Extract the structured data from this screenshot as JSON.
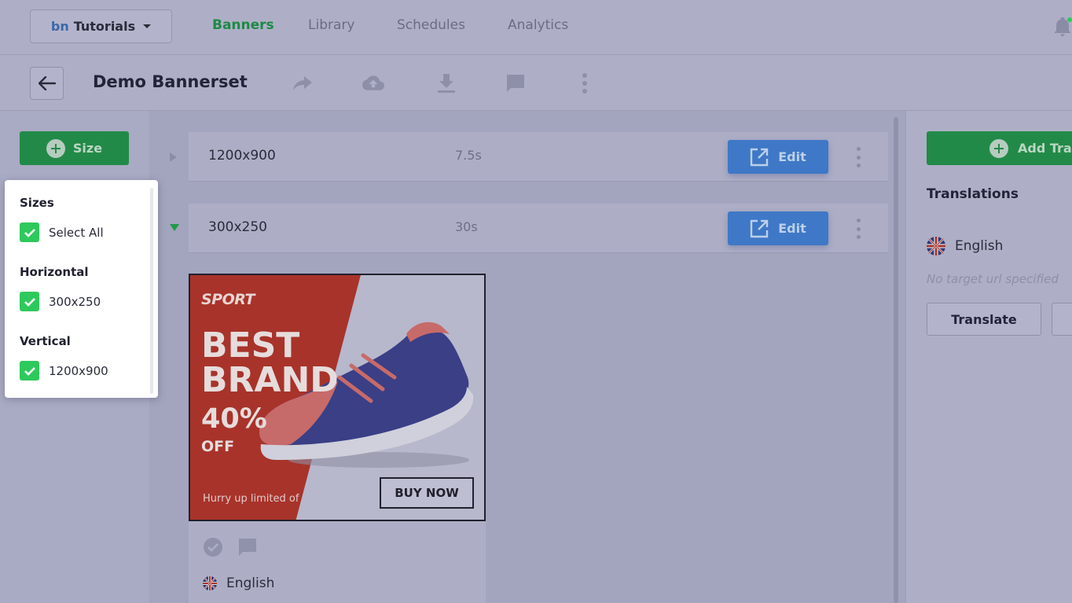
{
  "workspace": {
    "logo": "bn",
    "name": "Tutorials"
  },
  "nav": [
    {
      "label": "Banners",
      "active": true
    },
    {
      "label": "Library",
      "active": false
    },
    {
      "label": "Schedules",
      "active": false
    },
    {
      "label": "Analytics",
      "active": false
    }
  ],
  "toolbar": {
    "title": "Demo Bannerset",
    "icons": [
      "share-icon",
      "cloud-upload-icon",
      "download-icon",
      "comment-icon",
      "more-vertical-icon"
    ]
  },
  "left": {
    "size_button_label": "Size"
  },
  "size_filter": {
    "heading": "Sizes",
    "select_all": "Select All",
    "groups": [
      {
        "heading": "Horizontal",
        "item": "300x250"
      },
      {
        "heading": "Vertical",
        "item": "1200x900"
      }
    ]
  },
  "rows": [
    {
      "size": "1200x900",
      "duration": "7.5s",
      "edit_label": "Edit",
      "expanded": false
    },
    {
      "size": "300x250",
      "duration": "30s",
      "edit_label": "Edit",
      "expanded": true
    }
  ],
  "banner": {
    "logo": "SPORT",
    "headline_1": "BEST",
    "headline_2": "BRAND",
    "discount": "40%",
    "off": "OFF",
    "tagline": "Hurry up limited of",
    "cta": "BUY NOW",
    "language": "English"
  },
  "translations": {
    "add_button_label": "Add Tra",
    "title": "Translations",
    "language": "English",
    "no_url": "No target url specified",
    "translate_label": "Translate"
  },
  "colors": {
    "accent_green": "#228a48",
    "edit_blue": "#3f78c6",
    "check_green": "#2ec95c",
    "banner_red": "#a8332a"
  }
}
